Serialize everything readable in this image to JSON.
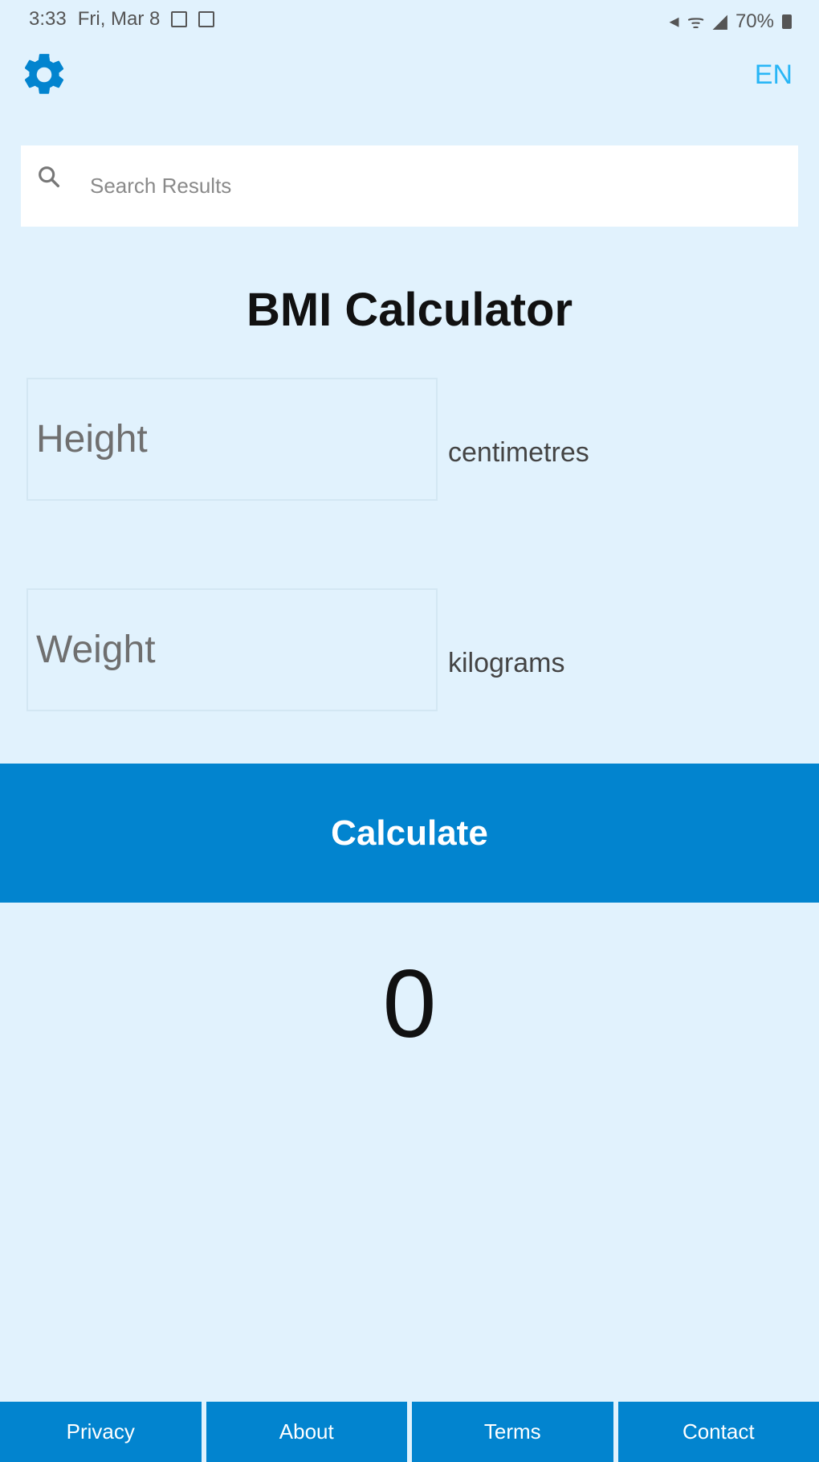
{
  "status_bar": {
    "time": "3:33",
    "date": "Fri, Mar 8",
    "battery": "70%"
  },
  "header": {
    "settings_icon": "gear-icon",
    "language": "EN",
    "accent_color": "#0284cf"
  },
  "search": {
    "icon": "search-icon",
    "placeholder": "Search Results"
  },
  "main": {
    "title": "BMI Calculator",
    "height": {
      "placeholder": "Height",
      "unit": "centimetres"
    },
    "weight": {
      "placeholder": "Weight",
      "unit": "kilograms"
    },
    "calculate_label": "Calculate",
    "result": "0"
  },
  "footer": {
    "items": [
      "Privacy",
      "About",
      "Terms",
      "Contact"
    ]
  }
}
